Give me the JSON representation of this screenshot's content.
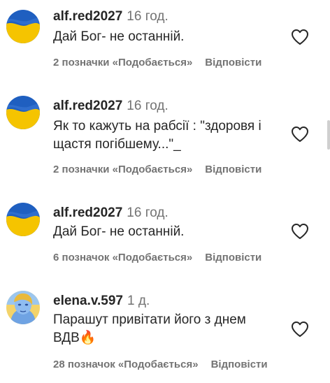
{
  "comments": [
    {
      "username": "alf.red2027",
      "time": "16 год.",
      "text": "Дай Бог- не останній.",
      "likes": "2 позначки «Подобається»",
      "reply": "Відповісти",
      "avatar": "ukrainian-flag"
    },
    {
      "username": "alf.red2027",
      "time": "16 год.",
      "text": "Як то кажуть на рабсії : \"здоровя і щастя погібшему...\"_",
      "likes": "2 позначки «Подобається»",
      "reply": "Відповісти",
      "avatar": "ukrainian-flag"
    },
    {
      "username": "alf.red2027",
      "time": "16 год.",
      "text": "Дай Бог- не останній.",
      "likes": "6 позначок «Подобається»",
      "reply": "Відповісти",
      "avatar": "ukrainian-flag"
    },
    {
      "username": "elena.v.597",
      "time": "1 д.",
      "text": "Парашут привітати його з днем ВДВ🔥",
      "likes": "28 позначок «Подобається»",
      "reply": "Відповісти",
      "avatar": "blue-yellow-portrait"
    }
  ],
  "colors": {
    "flag_blue": "#1f5fc0",
    "flag_yellow": "#f5c400",
    "text_primary": "#262626",
    "text_secondary": "#737373"
  },
  "icons": {
    "like": "heart-outline-icon"
  }
}
